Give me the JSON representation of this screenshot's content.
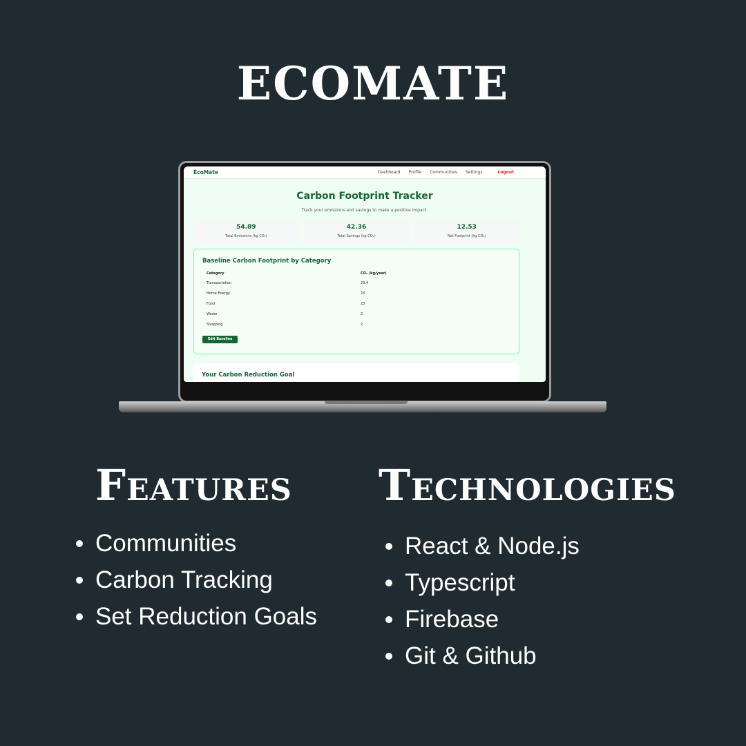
{
  "title": "ECOMATE",
  "app": {
    "nav": {
      "brand": "EcoMate",
      "links": [
        "Dashboard",
        "Profile",
        "Communities",
        "Settings"
      ],
      "logout": "Logout"
    },
    "heading": "Carbon Footprint Tracker",
    "subtitle": "Track your emissions and savings to make a positive impact.",
    "stats": [
      {
        "value": "54.89",
        "label": "Total Emissions (kg CO₂)"
      },
      {
        "value": "42.36",
        "label": "Total Savings (kg CO₂)"
      },
      {
        "value": "12.53",
        "label": "Net Footprint (kg CO₂)"
      }
    ],
    "baseline": {
      "title": "Baseline Carbon Footprint by Category",
      "headers": [
        "Category",
        "CO₂ (kg/year)"
      ],
      "rows": [
        [
          "Transportation",
          "23.4"
        ],
        [
          "Home Energy",
          "23"
        ],
        [
          "Food",
          "23"
        ],
        [
          "Waste",
          "2"
        ],
        [
          "Shopping",
          "2"
        ]
      ],
      "button": "Edit Baseline"
    },
    "goal_title": "Your Carbon Reduction Goal"
  },
  "features": {
    "heading": "Features",
    "items": [
      "Communities",
      "Carbon Tracking",
      "Set Reduction Goals"
    ]
  },
  "technologies": {
    "heading": "Technologies",
    "items": [
      "React & Node.js",
      "Typescript",
      "Firebase",
      "Git & Github"
    ]
  }
}
